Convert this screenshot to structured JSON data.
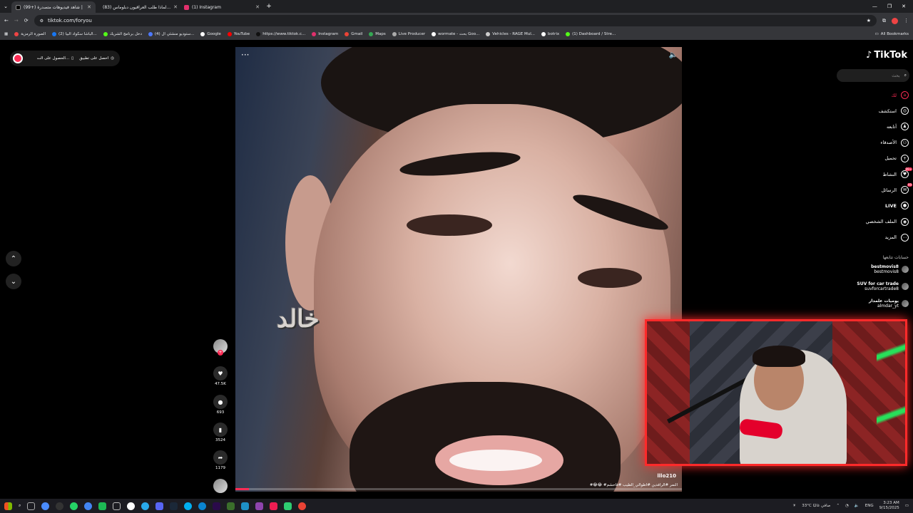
{
  "tabs": [
    {
      "title": "(99+) شاهد فيديوهات متصدرة |",
      "favicon": "tiktok",
      "active": true
    },
    {
      "title": "(83) لماذا طلب العراقيون دبلوماس...",
      "favicon": "youtube",
      "active": false
    },
    {
      "title": "(1) Instagram",
      "favicon": "instagram",
      "active": false
    }
  ],
  "address": {
    "url": "tiktok.com/foryou"
  },
  "bookmarks": {
    "items": [
      {
        "label": "الصورة الرمزية",
        "color": "#e44"
      },
      {
        "label": "(2) الباشا سكواد البيا...",
        "color": "#1877f2"
      },
      {
        "label": "دخل برنامج الشريك",
        "color": "#53fc18"
      },
      {
        "label": "(4) ستوديو منشئي ال...",
        "color": "#4d79ff"
      },
      {
        "label": "Google",
        "color": "#ffffff"
      },
      {
        "label": "YouTube",
        "color": "#ff0000"
      },
      {
        "label": "https://www.tiktok.c...",
        "color": "#111111"
      },
      {
        "label": "Instagram",
        "color": "#e1306c"
      },
      {
        "label": "Gmail",
        "color": "#ea4335"
      },
      {
        "label": "Maps",
        "color": "#34a853"
      },
      {
        "label": "Live Producer",
        "color": "#aaaaaa"
      },
      {
        "label": "wormate - بحث Goo...",
        "color": "#ffffff"
      },
      {
        "label": "Vehicles - RAGE Mul...",
        "color": "#cccccc"
      },
      {
        "label": "botrix",
        "color": "#ffffff"
      },
      {
        "label": "(1) Dashboard / Stre...",
        "color": "#53fc18"
      }
    ],
    "all": "All Bookmarks"
  },
  "getapp": {
    "app_label": "احصل على تطبيق",
    "pc_label": "الحصول على الت..."
  },
  "video": {
    "caption": "خالد",
    "author": "lllo210",
    "hashtags": "#😂😂 #النمر #الرافدين #اطوالي_الطيب #فاحشم",
    "progress": 0.03
  },
  "actions": {
    "likes": "47.5K",
    "comments": "693",
    "saves": "3524",
    "shares": "1179"
  },
  "sidebar": {
    "logo": "TikTok",
    "search_placeholder": "بحث",
    "nav": [
      {
        "label": "لك",
        "icon": "home-icon",
        "active": true
      },
      {
        "label": "استكشف",
        "icon": "compass-icon"
      },
      {
        "label": "أتابعه",
        "icon": "user-follow-icon"
      },
      {
        "label": "الأصدقاء",
        "icon": "friends-icon"
      },
      {
        "label": "تحميل",
        "icon": "upload-icon"
      },
      {
        "label": "النشاط",
        "icon": "activity-icon",
        "badge": "99+"
      },
      {
        "label": "الرسائل",
        "icon": "messages-icon",
        "badge": "99"
      },
      {
        "label": "LIVE",
        "icon": "live-icon"
      },
      {
        "label": "الملف الشخصي",
        "icon": "profile-icon"
      },
      {
        "label": "المزيد",
        "icon": "more-icon"
      }
    ],
    "following_label": "حسابات تتابعها",
    "accounts": [
      {
        "name": "bestmovis8",
        "handle": "bestmovis8"
      },
      {
        "name": "SUV for car trade",
        "handle": "suvforcartrade8"
      },
      {
        "name": "يوميات علمدار",
        "handle": "almdar_yt"
      }
    ]
  },
  "taskbar": {
    "weather": "33°C  صافي غالبًا",
    "lang": "ENG",
    "time": "3:23 AM",
    "date": "9/15/2025"
  }
}
